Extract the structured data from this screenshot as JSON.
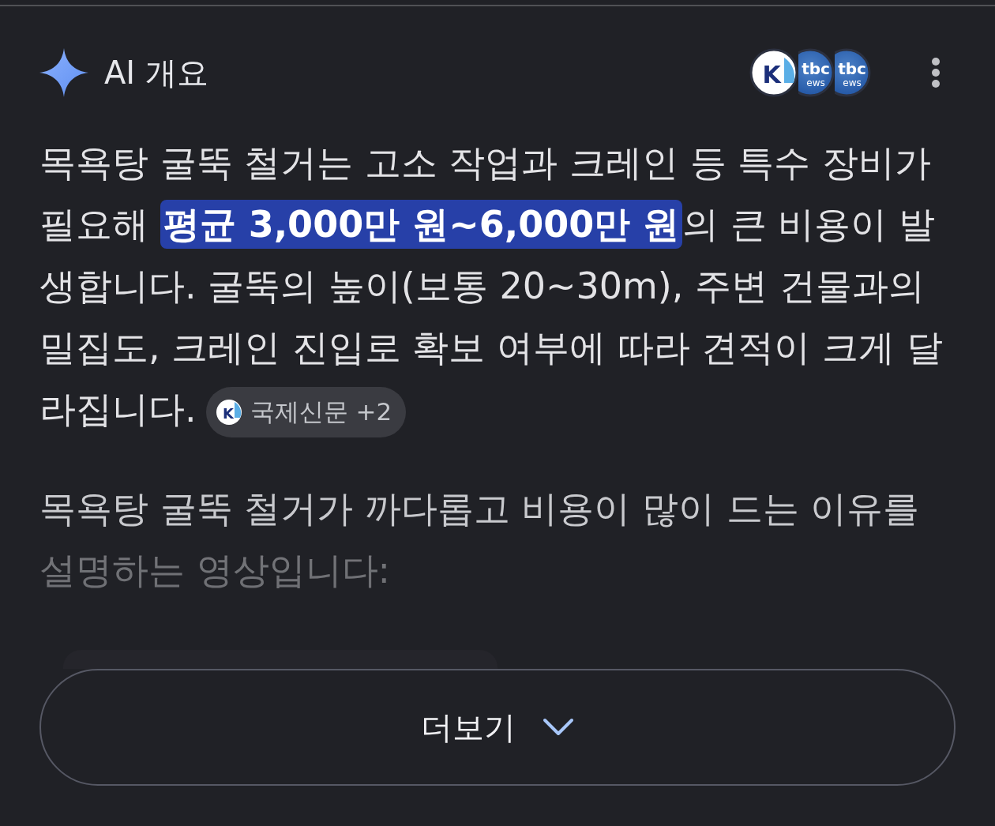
{
  "header": {
    "title": "AI 개요",
    "sources": [
      {
        "kind": "k",
        "label": "K"
      },
      {
        "kind": "tbc",
        "label": "tbc",
        "sublabel": "ews"
      },
      {
        "kind": "tbc",
        "label": "tbc",
        "sublabel": "ews"
      }
    ]
  },
  "summary": {
    "text": "목욕탕 굴뚝 철거는 고소 작업과 크레인 등 특수 장비가 필요해 **평균 3,000만 원~6,000만 원**의 큰 비용이 발생합니다. 굴뚝의 높이(보통 20~30m), 주변 건물과의 밀집도, 크레인 진입로 확보 여부에 따라 견적이 크게 달라집니다.",
    "citation": {
      "logo": "K",
      "label": "국제신문 +2"
    }
  },
  "video_intro": "목욕탕 굴뚝 철거가 까다롭고 비용이 많이 드는 이유를 설명하는 영상입니다:",
  "more_button": {
    "label": "더보기"
  }
}
